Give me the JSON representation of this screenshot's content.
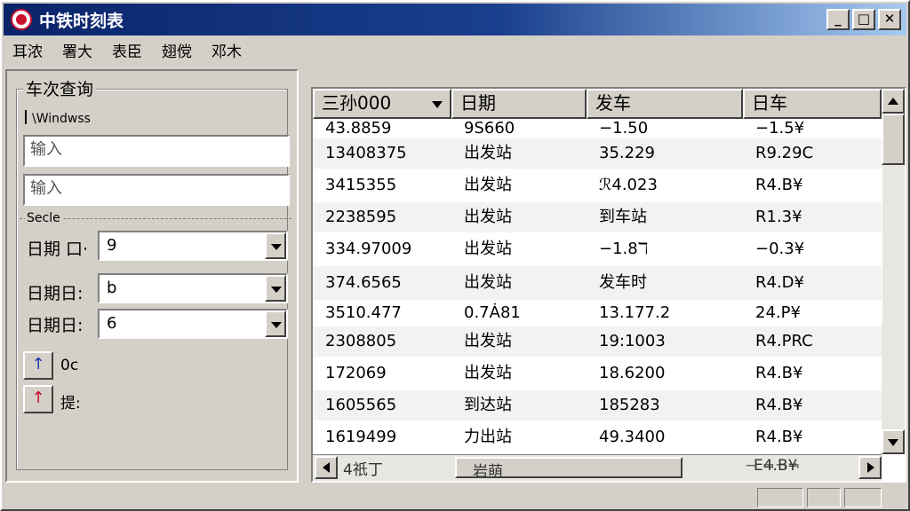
{
  "window": {
    "title": "中铁时刻表"
  },
  "menu": {
    "items": [
      "耳浓",
      "署大",
      "表臣",
      "翅傥",
      "邓木"
    ]
  },
  "left": {
    "group_title": "车次查询",
    "path_label": "\\Windwss",
    "input1_placeholder": "输入",
    "input2_placeholder": "输入",
    "section_label": "Secle",
    "fields": [
      {
        "label": "日期 口·",
        "value": "9"
      },
      {
        "label": "日期日:",
        "value": "b"
      },
      {
        "label": "日期日:",
        "value": "6"
      }
    ],
    "buttons": [
      {
        "glyph": "↑",
        "label": "0c",
        "color": "#1a3aa8"
      },
      {
        "glyph": "↑",
        "label": "提:",
        "color": "#c8102e"
      }
    ]
  },
  "table": {
    "headers": [
      "三孙000",
      "日期",
      "发车",
      "日车"
    ],
    "rows": [
      [
        "43.8859",
        "9S660",
        "−1.50",
        "−1.5¥"
      ],
      [
        "13408375",
        "出发站",
        "35.229",
        "R9.29C"
      ],
      [
        "3415355",
        "出发站",
        "ℛ4.023",
        "R4.B¥"
      ],
      [
        "2238595",
        "出发站",
        "到车站",
        "R1.3¥"
      ],
      [
        "334.97009",
        "出发站",
        "−1.8ℸ",
        "−0.3¥"
      ],
      [
        "374.6565",
        "出发站",
        "发车时",
        "R4.D¥"
      ],
      [
        "3510.477",
        "0.7Ȧ81",
        "13.177.2",
        "24.P¥"
      ],
      [
        "2308805",
        "出发站",
        "19:1003",
        "R4.PRC"
      ],
      [
        "172069",
        "出发站",
        "18.6200",
        "R4.B¥"
      ],
      [
        "1605565",
        "到达站",
        "185283",
        "R4.B¥"
      ],
      [
        "1619499",
        "力出站",
        "49.3400",
        "R4.B¥"
      ]
    ],
    "hscroll_left": "4祇丁",
    "hscroll_mid": "岩萌",
    "hscroll_tail": "− ¬¬¬",
    "hscroll_right": "E4.B¥"
  }
}
